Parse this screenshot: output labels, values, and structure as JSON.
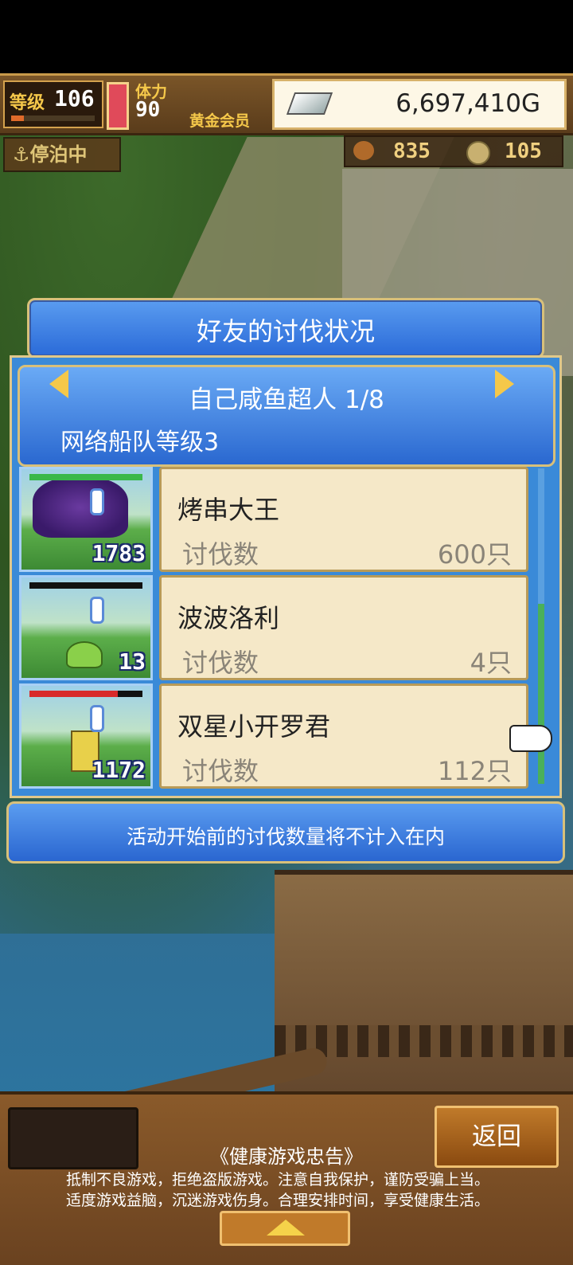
{
  "hud": {
    "level_label": "等级",
    "level": "106",
    "level_progress": 0.15,
    "stamina_label": "体力",
    "stamina": "90",
    "membership": "黄金会员",
    "money": "6,697,410G",
    "status": "停泊中",
    "resource_a": "835",
    "resource_b": "105"
  },
  "dialog": {
    "title": "好友的讨伐状况",
    "user": "自己咸鱼超人 1/8",
    "fleet_level": "网络船队等级3",
    "entries": [
      {
        "name": "烤串大王",
        "label": "讨伐数",
        "value": "600只",
        "count": "1783",
        "hp": 1.0
      },
      {
        "name": "波波洛利",
        "label": "讨伐数",
        "value": "4只",
        "count": "13",
        "hp": 0.0
      },
      {
        "name": "双星小开罗君",
        "label": "讨伐数",
        "value": "112只",
        "count": "1172",
        "hp": 0.78
      }
    ],
    "note": "活动开始前的讨伐数量将不计入在内"
  },
  "bottom": {
    "back_label": "返回",
    "advice_title": "《健康游戏忠告》",
    "advice_line1": "抵制不良游戏，拒绝盗版游戏。注意自我保护，谨防受骗上当。",
    "advice_line2": "适度游戏益脑，沉迷游戏伤身。合理安排时间，享受健康生活。"
  },
  "colors": {
    "accent_blue": "#2a6ad8",
    "gold": "#f5c84a",
    "card_bg": "#f5e8c8"
  }
}
